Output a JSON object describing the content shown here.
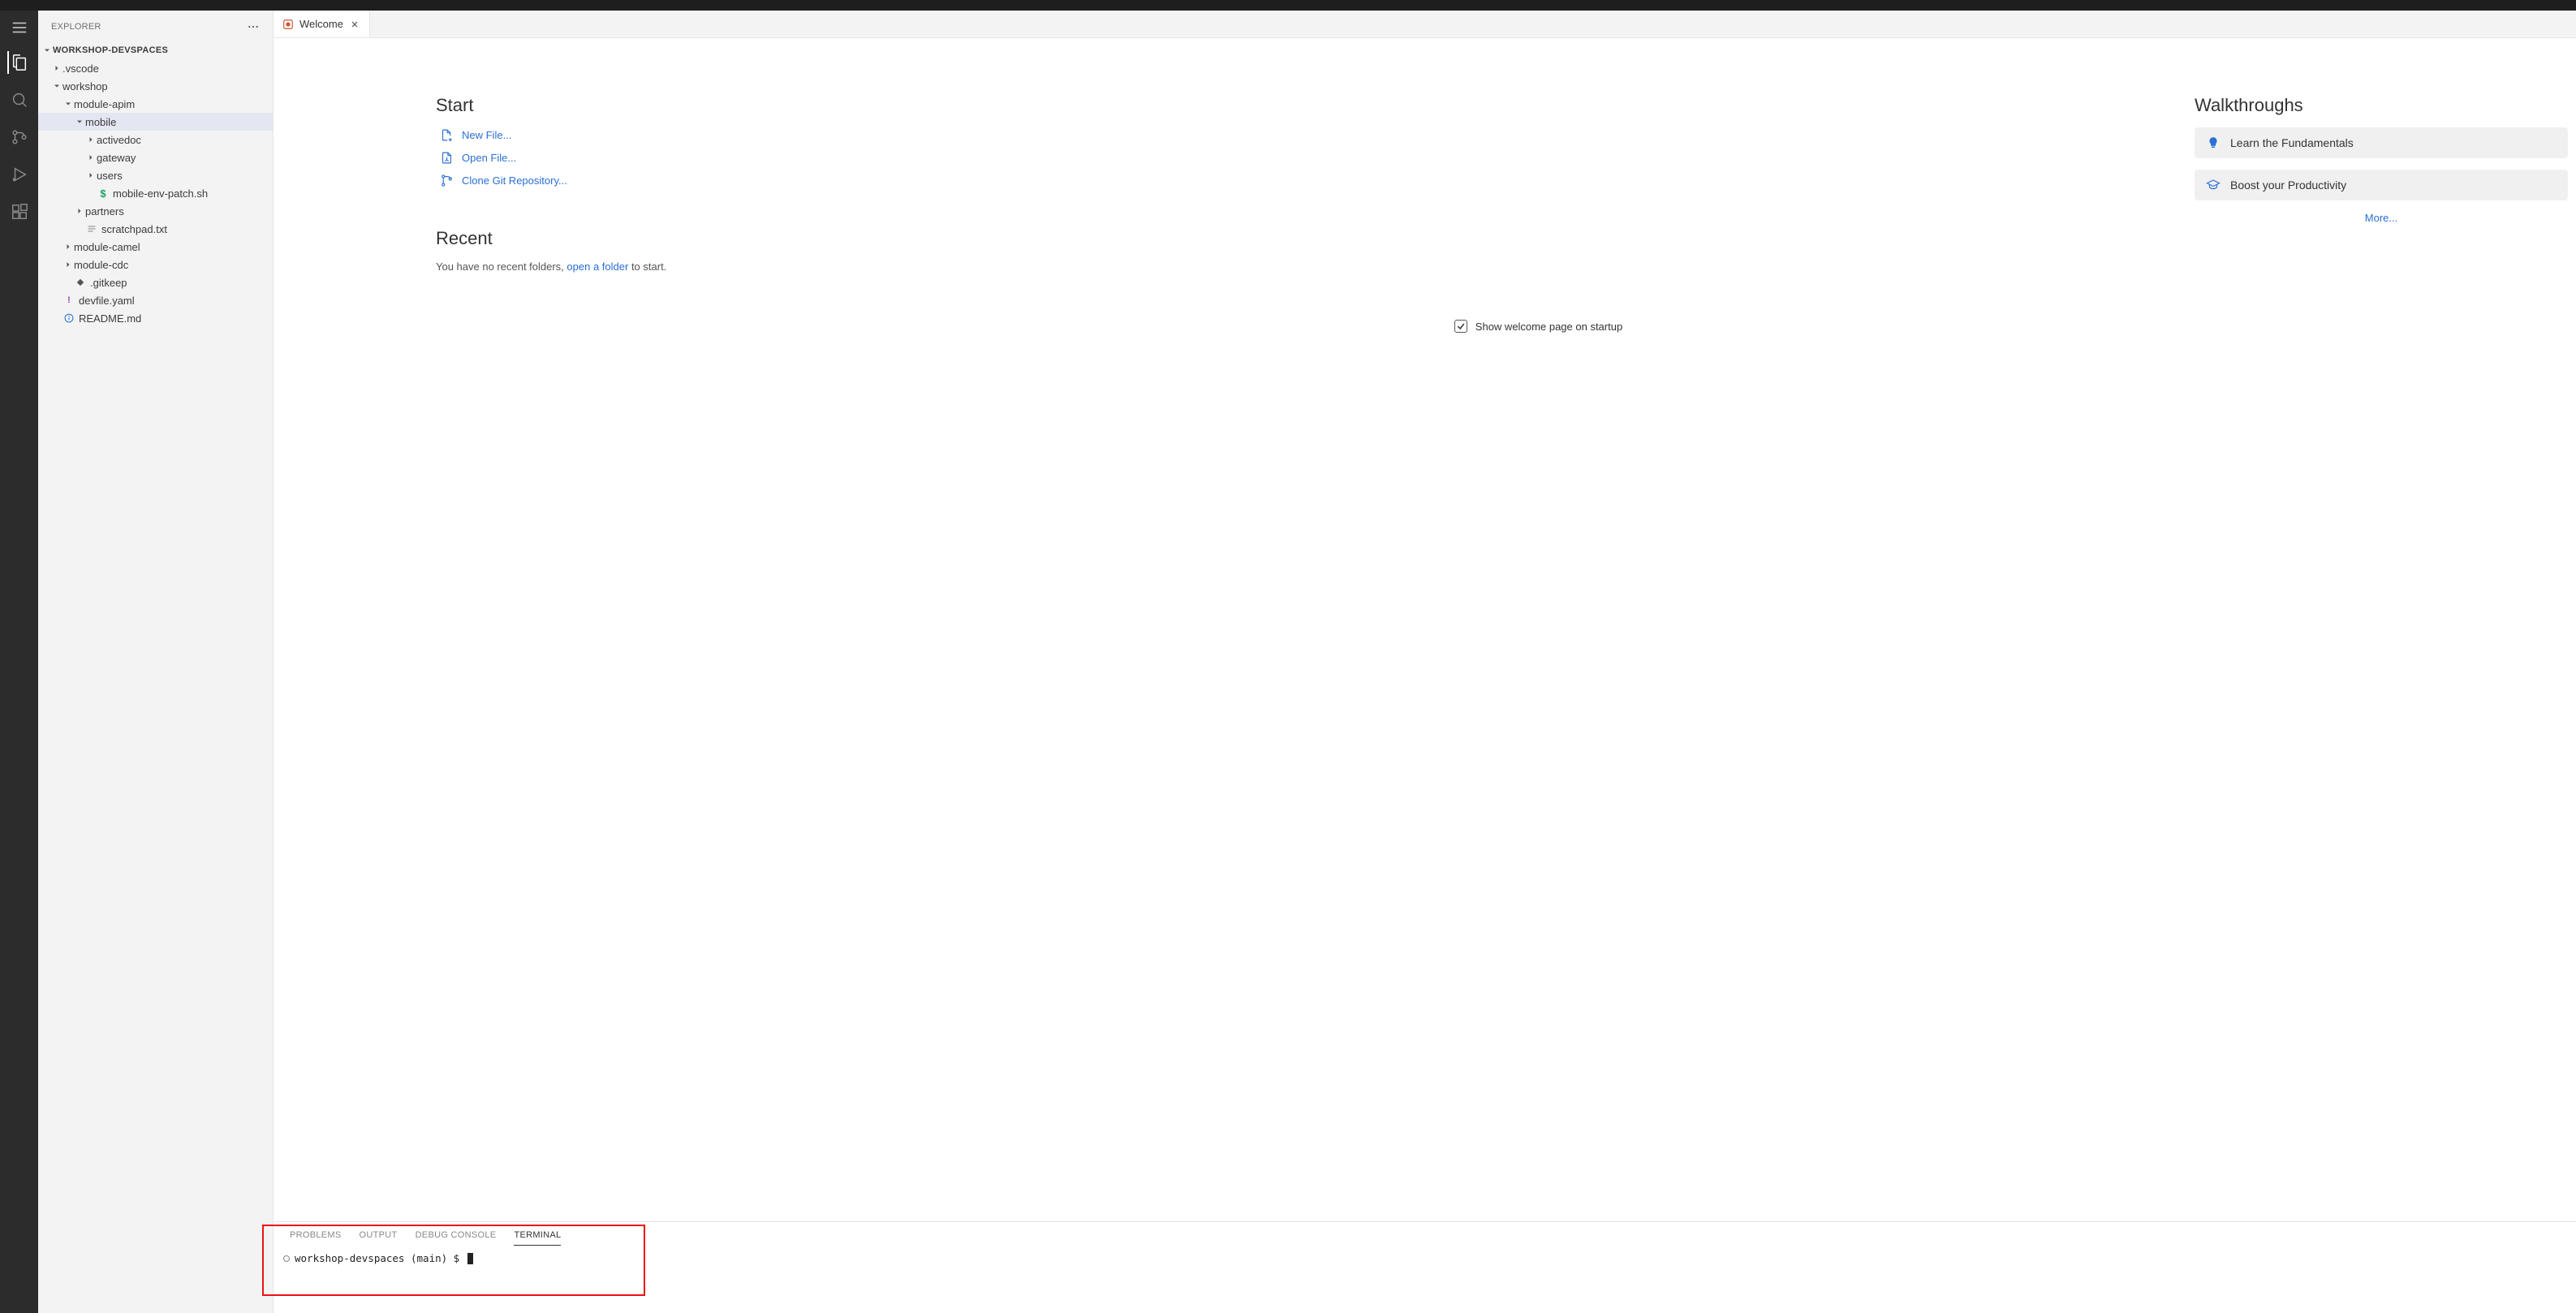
{
  "sidebar": {
    "title": "EXPLORER",
    "root": "WORKSHOP-DEVSPACES",
    "tree": {
      "vscode": ".vscode",
      "workshop": "workshop",
      "module_apim": "module-apim",
      "mobile": "mobile",
      "activedoc": "activedoc",
      "gateway": "gateway",
      "users": "users",
      "mobile_env_patch": "mobile-env-patch.sh",
      "partners": "partners",
      "scratchpad": "scratchpad.txt",
      "module_camel": "module-camel",
      "module_cdc": "module-cdc",
      "gitkeep": ".gitkeep",
      "devfile": "devfile.yaml",
      "readme": "README.md"
    }
  },
  "tab": {
    "label": "Welcome"
  },
  "welcome": {
    "start_heading": "Start",
    "new_file": "New File...",
    "open_file": "Open File...",
    "clone_repo": "Clone Git Repository...",
    "recent_heading": "Recent",
    "recent_prefix": "You have no recent folders, ",
    "recent_link": "open a folder",
    "recent_suffix": " to start.",
    "walk_heading": "Walkthroughs",
    "walk1": "Learn the Fundamentals",
    "walk2": "Boost your Productivity",
    "more": "More...",
    "startup_label": "Show welcome page on startup"
  },
  "panel": {
    "tabs": {
      "problems": "PROBLEMS",
      "output": "OUTPUT",
      "debug": "DEBUG CONSOLE",
      "terminal": "TERMINAL"
    },
    "prompt": "workshop-devspaces (main) $ "
  }
}
